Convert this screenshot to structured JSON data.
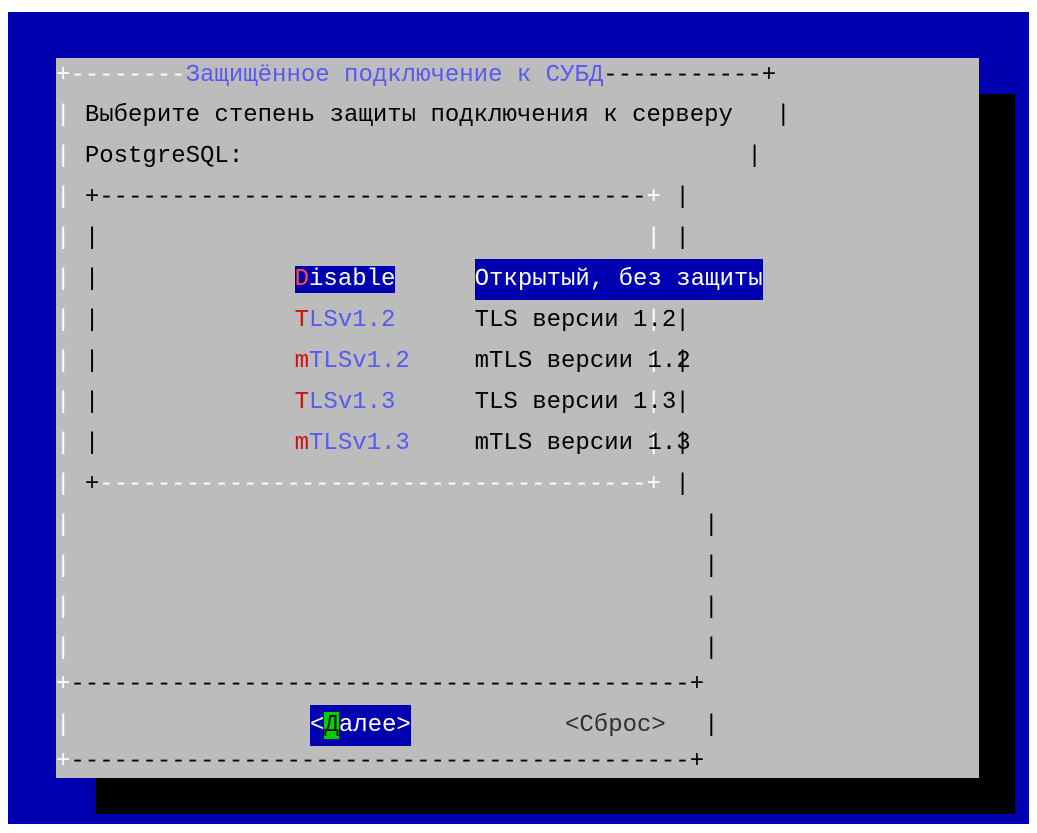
{
  "dialog": {
    "title": "Защищённое подключение к СУБД",
    "prompt_line1": "Выберите степень защиты подключения к серверу",
    "prompt_line2": "PostgreSQL:"
  },
  "menu": {
    "items": [
      {
        "hotkey": "D",
        "rest": "isable",
        "description": "Открытый, без защиты",
        "selected": true
      },
      {
        "hotkey": "T",
        "rest": "LSv1.2",
        "description": "TLS версии 1.2",
        "selected": false
      },
      {
        "hotkey": "m",
        "rest": "TLSv1.2",
        "description": "mTLS версии 1.2",
        "selected": false
      },
      {
        "hotkey": "T",
        "rest": "LSv1.3",
        "description": "TLS версии 1.3",
        "selected": false
      },
      {
        "hotkey": "m",
        "rest": "TLSv1.3",
        "description": "mTLS версии 1.3",
        "selected": false
      }
    ]
  },
  "buttons": {
    "ok": {
      "open": "<",
      "hotkey": "Д",
      "rest": "алее>"
    },
    "reset": {
      "label": "<Сброс>"
    }
  },
  "colors": {
    "screen_background": "#0000b0",
    "dialog_background": "#bcbcbc",
    "selection_background": "#0000b0",
    "hotkey_red": "#d01010",
    "tag_blue": "#5858f4",
    "button_hotkey_green": "#00d000"
  }
}
